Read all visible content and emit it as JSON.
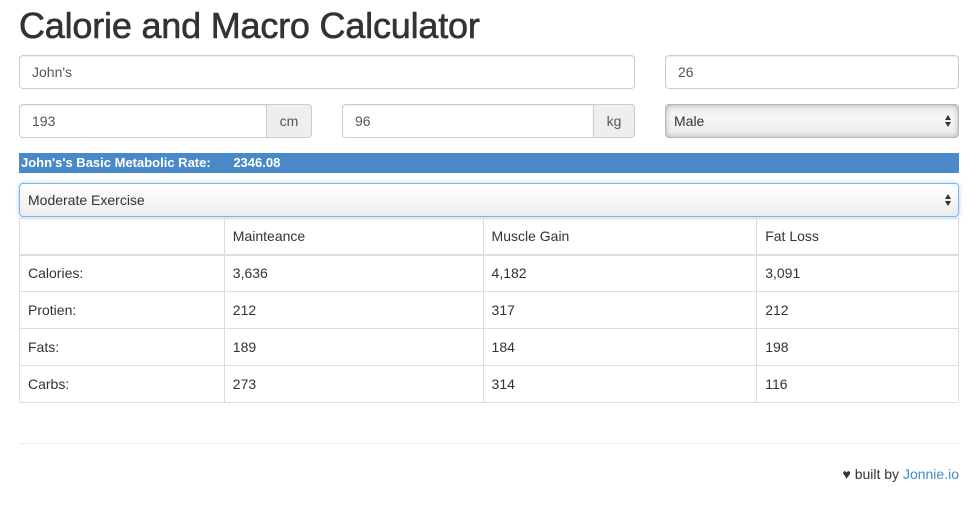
{
  "title": "Calorie and Macro Calculator",
  "form": {
    "name_value": "John's",
    "age_value": "26",
    "height_value": "193",
    "height_unit": "cm",
    "weight_value": "96",
    "weight_unit": "kg",
    "gender_selected": "Male",
    "activity_selected": "Moderate Exercise"
  },
  "bmr": {
    "label": "John's's Basic Metabolic Rate:",
    "value": "2346.08",
    "color": "#4a89c8"
  },
  "table": {
    "headers": [
      "",
      "Mainteance",
      "Muscle Gain",
      "Fat Loss"
    ],
    "rows": [
      {
        "label": "Calories:",
        "cells": [
          "3,636",
          "4,182",
          "3,091"
        ]
      },
      {
        "label": "Protien:",
        "cells": [
          "212",
          "317",
          "212"
        ]
      },
      {
        "label": "Fats:",
        "cells": [
          "189",
          "184",
          "198"
        ]
      },
      {
        "label": "Carbs:",
        "cells": [
          "273",
          "314",
          "116"
        ]
      }
    ]
  },
  "footer": {
    "heart_icon": "♥",
    "text": "built by",
    "link_text": "Jonnie.io",
    "link_color": "#428bca"
  }
}
